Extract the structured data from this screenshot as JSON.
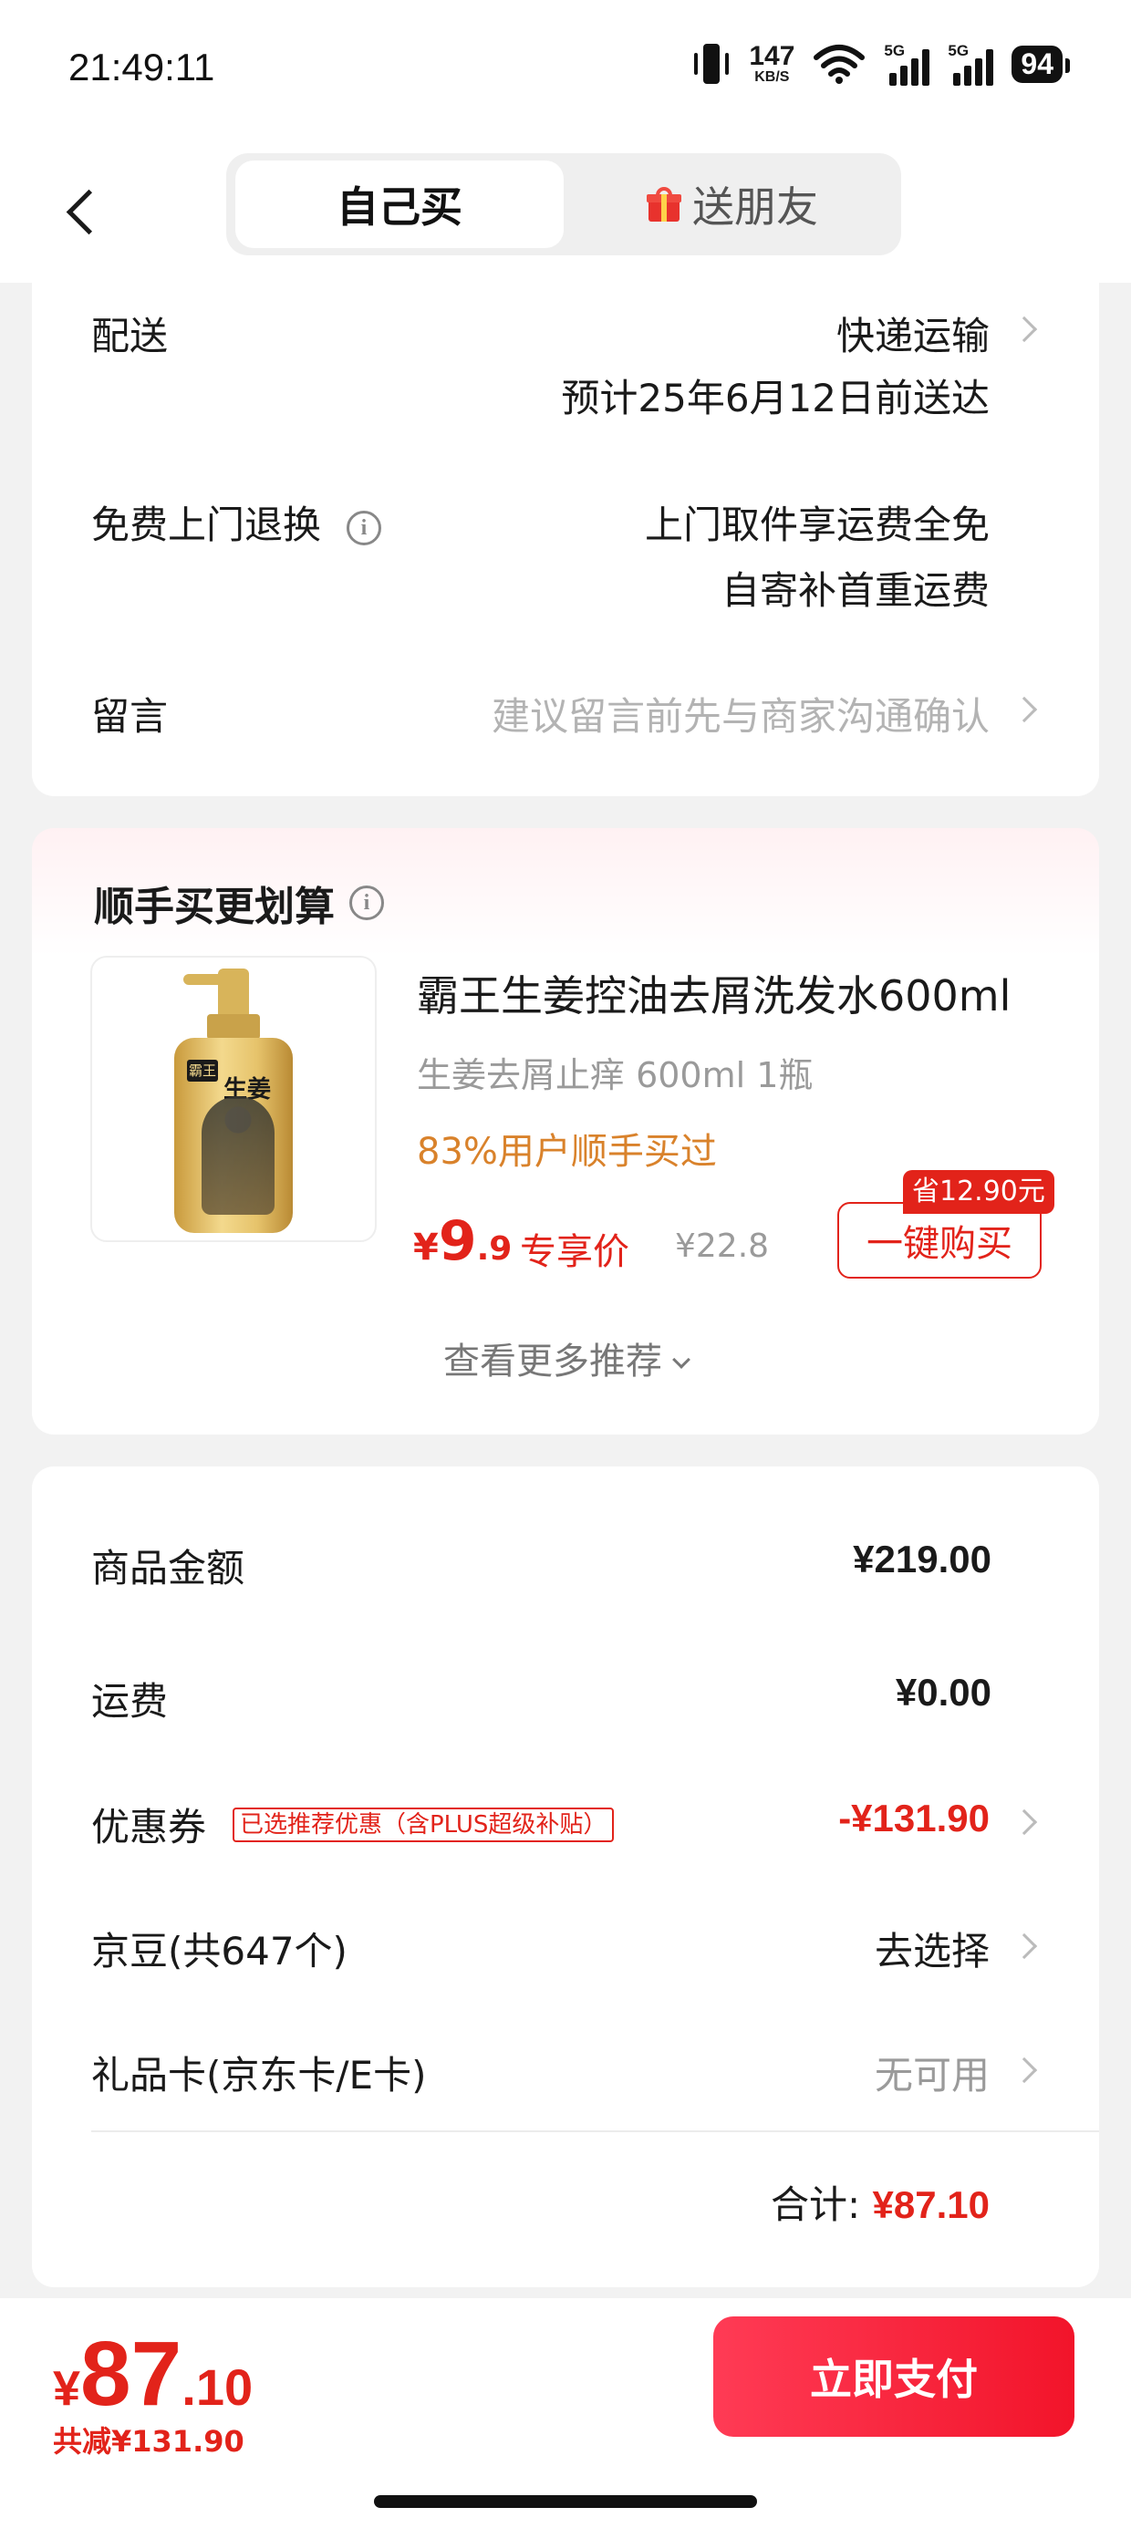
{
  "status_bar": {
    "time": "21:49:11",
    "net_speed": "147",
    "net_unit": "KB/S",
    "network1": "5G",
    "network2": "5G",
    "battery": "94"
  },
  "header": {
    "tab_self": "自己买",
    "tab_gift": "送朋友"
  },
  "delivery": {
    "label": "配送",
    "method": "快递运输",
    "eta": "预计25年6月12日前送达"
  },
  "returns": {
    "label": "免费上门退换",
    "line1": "上门取件享运费全免",
    "line2": "自寄补首重运费"
  },
  "message": {
    "label": "留言",
    "placeholder": "建议留言前先与商家沟通确认"
  },
  "addon": {
    "title": "顺手买更划算",
    "product_name": "霸王生姜控油去屑洗发水600ml",
    "spec": "生姜去屑止痒 600ml 1瓶",
    "bought_ratio": "83%用户顺手买过",
    "price_symbol": "¥",
    "price_int": "9",
    "price_dec": ".9",
    "exclusive_label": "专享价",
    "original_price": "¥22.8",
    "save_badge": "省12.90元",
    "buy_button": "一键购买",
    "bottle_brand": "霸王",
    "bottle_text": "生姜",
    "more_label": "查看更多推荐"
  },
  "summary": {
    "goods_label": "商品金额",
    "goods_value": "¥219.00",
    "shipping_label": "运费",
    "shipping_value": "¥0.00",
    "coupon_label": "优惠券",
    "coupon_tag": "已选推荐优惠（含PLUS超级补贴）",
    "coupon_value": "-¥131.90",
    "jd_beans_label": "京豆(共647个)",
    "jd_beans_value": "去选择",
    "giftcard_label": "礼品卡(京东卡/E卡)",
    "giftcard_value": "无可用",
    "total_label": "合计:",
    "total_value": "¥87.10"
  },
  "bottom_bar": {
    "price_symbol": "¥",
    "price_int": "87",
    "price_dec": ".10",
    "saved": "共减¥131.90",
    "pay_button": "立即支付"
  },
  "colors": {
    "accent": "#e2231a",
    "pay_gradient_start": "#ff3b55",
    "pay_gradient_end": "#f2142a",
    "orange": "#d9822b"
  }
}
